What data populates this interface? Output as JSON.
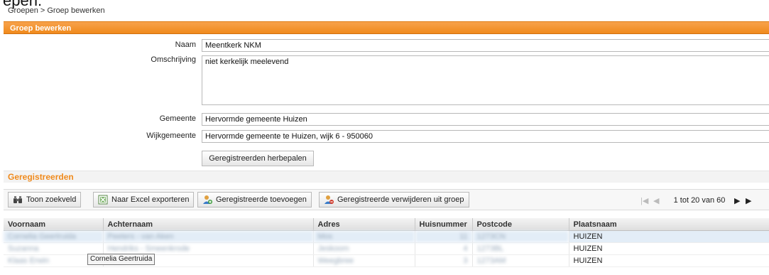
{
  "top_cut_text": "epen:",
  "breadcrumb": "Groepen > Groep bewerken",
  "panel_title": "Groep bewerken",
  "form": {
    "naam_label": "Naam",
    "naam_value": "Meentkerk NKM",
    "omschrijving_label": "Omschrijving",
    "omschrijving_value": "niet kerkelijk meelevend",
    "gemeente_label": "Gemeente",
    "gemeente_value": "Hervormde gemeente Huizen",
    "wijkgemeente_label": "Wijkgemeente",
    "wijkgemeente_value": "Hervormde gemeente te Huizen, wijk 6 - 950060",
    "herbepalen_button": "Geregistreerden herbepalen"
  },
  "section_title": "Geregistreerden",
  "toolbar": {
    "toon_zoekveld": "Toon zoekveld",
    "excel_export": "Naar Excel exporteren",
    "toevoegen": "Geregistreerde toevoegen",
    "verwijderen": "Geregistreerde verwijderen uit groep"
  },
  "pager": {
    "range_text": "1 tot 20 van 60"
  },
  "grid": {
    "columns": [
      "Voornaam",
      "Achternaam",
      "Adres",
      "Huisnummer",
      "Postcode",
      "Plaatsnaam"
    ],
    "rows": [
      {
        "voornaam": "Cornelia Geertruida",
        "achternaam": "Peeters - van Aken",
        "adres": "Mos",
        "huisnummer": "11",
        "postcode": "1273CN",
        "plaatsnaam": "HUIZEN"
      },
      {
        "voornaam": "Suzanna",
        "achternaam": "Hendriks - Smeenkrode",
        "adres": "Jeskoom",
        "huisnummer": "4",
        "postcode": "1273BL",
        "plaatsnaam": "HUIZEN"
      },
      {
        "voornaam": "Klaas Erwin",
        "achternaam": "Roos",
        "adres": "Weegbree",
        "huisnummer": "3",
        "postcode": "1273AM",
        "plaatsnaam": "HUIZEN"
      }
    ]
  },
  "tooltip": "Cornelia Geertruida"
}
